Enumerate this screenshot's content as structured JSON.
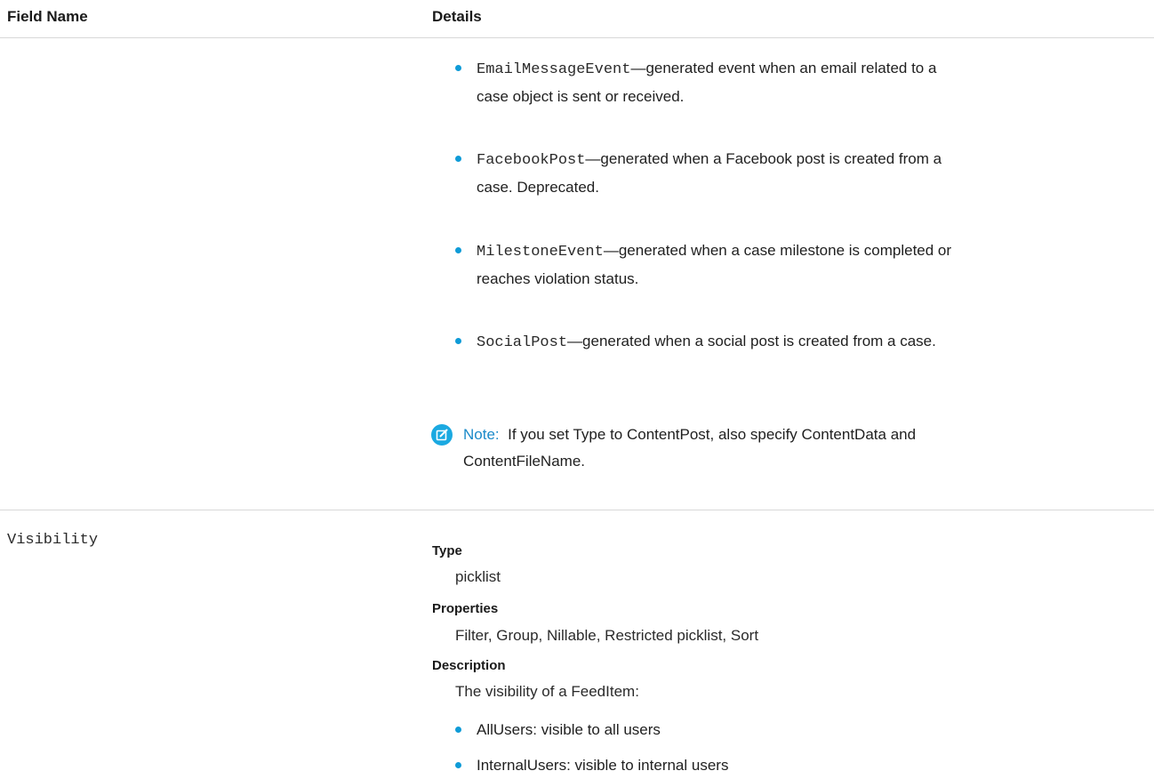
{
  "table_header": {
    "field_name": "Field Name",
    "details": "Details"
  },
  "type_values": [
    {
      "code": "EmailMessageEvent",
      "line1": "—generated event when an email related to a",
      "line2": "case object is sent or received."
    },
    {
      "code": "FacebookPost",
      "line1": "—generated when a Facebook post is created from a",
      "line2": "case. Deprecated."
    },
    {
      "code": "MilestoneEvent",
      "line1": "—generated when a case milestone is completed or",
      "line2": "reaches violation status."
    },
    {
      "code": "SocialPost",
      "line1": "—generated when a social post is created from a case.",
      "line2": ""
    }
  ],
  "note": {
    "icon": "edit-note-icon",
    "label": "Note:",
    "line1": "If you set Type to ContentPost, also specify ContentData and",
    "line2": "ContentFileName."
  },
  "visibility_field": {
    "name": "Visibility",
    "type_label": "Type",
    "type_value": "picklist",
    "properties_label": "Properties",
    "properties_value": "Filter, Group, Nillable, Restricted picklist, Sort",
    "description_label": "Description",
    "description_value": "The visibility of a FeedItem:",
    "options": [
      "AllUsers: visible to all users",
      "InternalUsers: visible to internal users"
    ]
  },
  "colors": {
    "accent": "#0f9bd7",
    "note_icon": "#1ba9e1",
    "note_label": "#1b8ac9",
    "divider": "#d8d8d8"
  }
}
